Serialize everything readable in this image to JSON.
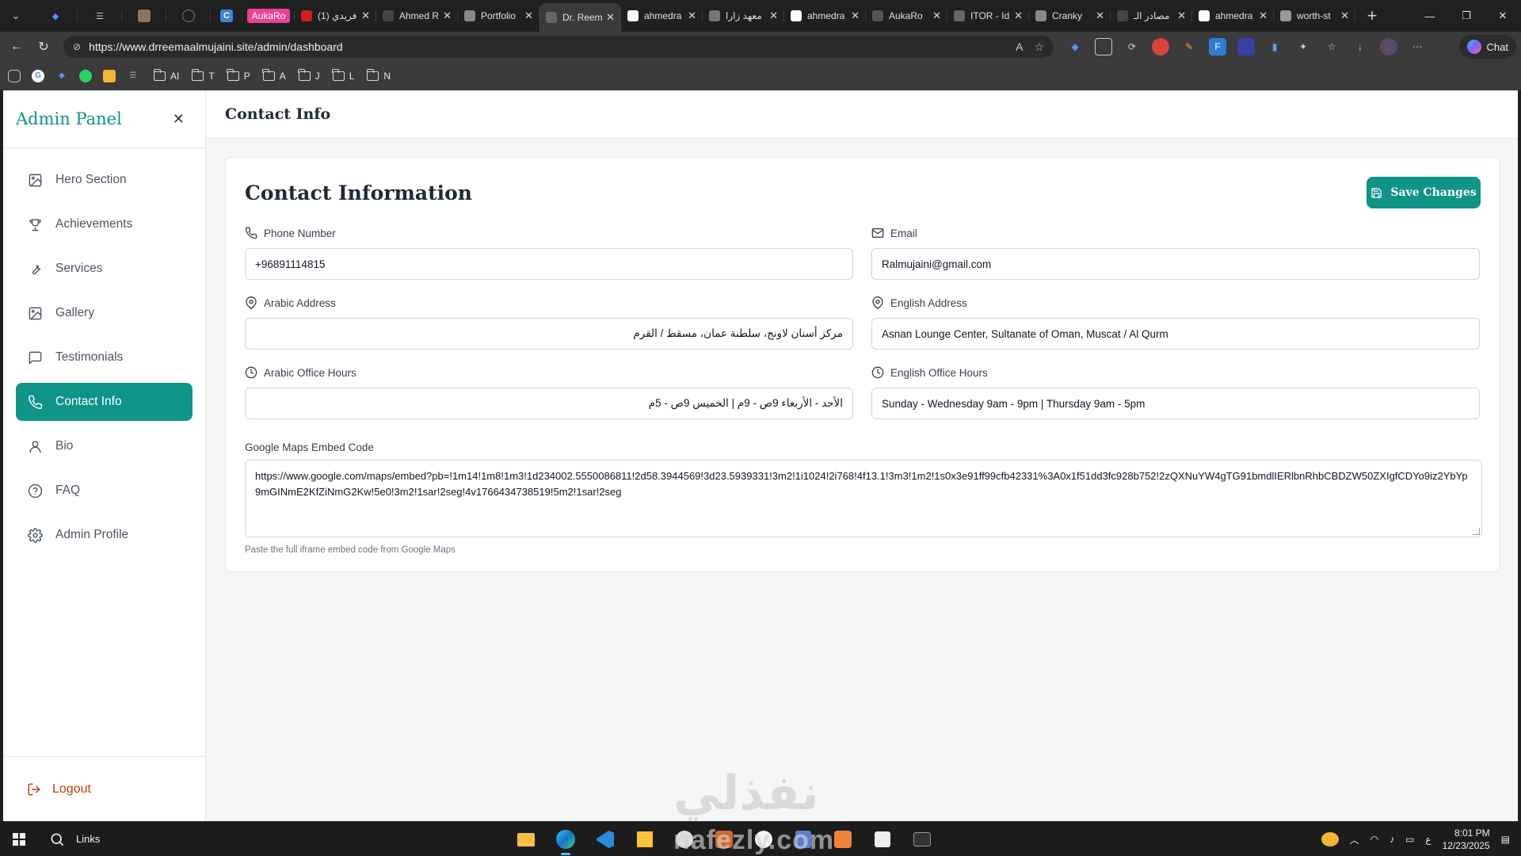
{
  "browser": {
    "tabs": [
      {
        "label": "فريدي (1)",
        "fav_color": "#cc1f1f"
      },
      {
        "label": "Ahmed R",
        "fav_color": "#444444"
      },
      {
        "label": "Portfolio",
        "fav_color": "#888888"
      },
      {
        "label": "Dr. Reem",
        "fav_color": "#666666",
        "active": true
      },
      {
        "label": "ahmedra",
        "fav_color": "#ffffff"
      },
      {
        "label": "معهد زارا",
        "fav_color": "#777777"
      },
      {
        "label": "ahmedra",
        "fav_color": "#ffffff"
      },
      {
        "label": "AukaRo",
        "fav_color": "#555555"
      },
      {
        "label": "ITOR - Id",
        "fav_color": "#666666"
      },
      {
        "label": "Cranky",
        "fav_color": "#888888"
      },
      {
        "label": "مصادر الـ",
        "fav_color": "#444444"
      },
      {
        "label": "ahmedra",
        "fav_color": "#ffffff"
      },
      {
        "label": "worth-st",
        "fav_color": "#999999"
      }
    ],
    "pinned_badge": "AukaRo",
    "pinned_c": "C",
    "url": "https://www.drreemaalmujaini.site/admin/dashboard",
    "chat_label": "Chat",
    "bookmarks": [
      "AI",
      "T",
      "P",
      "A",
      "J",
      "L",
      "N"
    ]
  },
  "sidebar": {
    "title": "Admin Panel",
    "items": [
      {
        "label": "Hero Section",
        "icon": "image-icon"
      },
      {
        "label": "Achievements",
        "icon": "trophy-icon"
      },
      {
        "label": "Services",
        "icon": "wrench-icon"
      },
      {
        "label": "Gallery",
        "icon": "image-icon"
      },
      {
        "label": "Testimonials",
        "icon": "message-icon"
      },
      {
        "label": "Contact Info",
        "icon": "phone-icon",
        "active": true
      },
      {
        "label": "Bio",
        "icon": "user-icon"
      },
      {
        "label": "FAQ",
        "icon": "help-circle-icon"
      },
      {
        "label": "Admin Profile",
        "icon": "gear-icon"
      }
    ],
    "logout_label": "Logout"
  },
  "main": {
    "header_title": "Contact Info",
    "card_title": "Contact Information",
    "save_label": "Save Changes",
    "fields": {
      "phone": {
        "label": "Phone Number",
        "value": "+96891114815"
      },
      "email": {
        "label": "Email",
        "value": "Ralmujaini@gmail.com"
      },
      "arabic_address": {
        "label": "Arabic Address",
        "value": "مركز أسنان لاونج، سلطنة عمان، مسقط / القرم"
      },
      "english_address": {
        "label": "English Address",
        "value": "Asnan Lounge Center, Sultanate of Oman, Muscat / Al Qurm"
      },
      "arabic_hours": {
        "label": "Arabic Office Hours",
        "value": "الأحد - الأربعاء 9ص - 9م | الخميس 9ص - 5م"
      },
      "english_hours": {
        "label": "English Office Hours",
        "value": "Sunday - Wednesday 9am - 9pm | Thursday 9am - 5pm"
      }
    },
    "maps": {
      "label": "Google Maps Embed Code",
      "value": "https://www.google.com/maps/embed?pb=!1m14!1m8!1m3!1d234002.5550086811!2d58.3944569!3d23.5939331!3m2!1i1024!2i768!4f13.1!3m3!1m2!1s0x3e91ff99cfb42331%3A0x1f51dd3fc928b752!2zQXNuYW4gTG91bmdlIERlbnRhbCBDZW50ZXIgfCDYo9iz2YbYp9mGINmE2KfZiNmG2Kw!5e0!3m2!1sar!2seg!4v1766434738519!5m2!1sar!2seg",
      "hint": "Paste the full iframe embed code from Google Maps"
    }
  },
  "watermark": {
    "arabic": "نفذلي",
    "latin": "nafezly.com"
  },
  "taskbar": {
    "search_label": "Links",
    "time": "8:01 PM",
    "date": "12/23/2025",
    "lang": "ع"
  },
  "colors": {
    "accent": "#0f9488",
    "logout": "#c2410c"
  }
}
